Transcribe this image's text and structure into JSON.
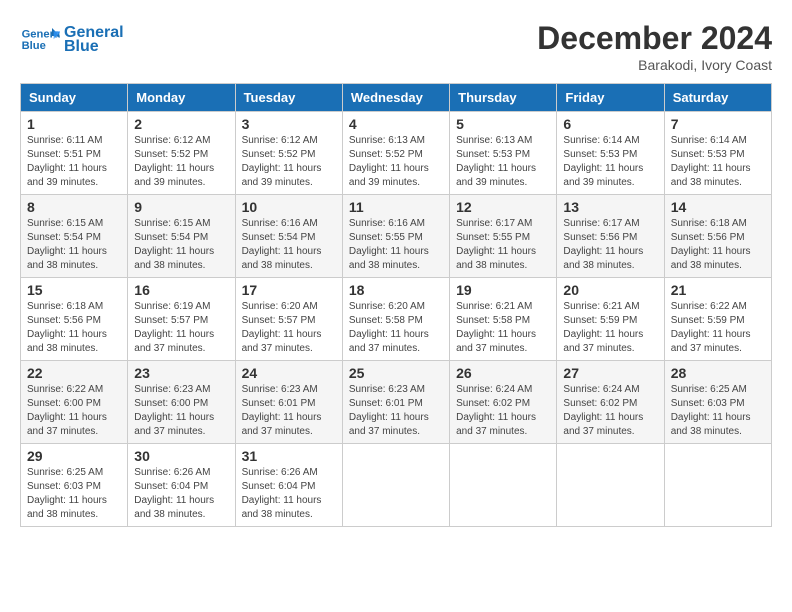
{
  "header": {
    "logo_line1": "General",
    "logo_line2": "Blue",
    "month_title": "December 2024",
    "location": "Barakodi, Ivory Coast"
  },
  "weekdays": [
    "Sunday",
    "Monday",
    "Tuesday",
    "Wednesday",
    "Thursday",
    "Friday",
    "Saturday"
  ],
  "weeks": [
    [
      {
        "day": "1",
        "sunrise": "6:11 AM",
        "sunset": "5:51 PM",
        "daylight": "11 hours and 39 minutes."
      },
      {
        "day": "2",
        "sunrise": "6:12 AM",
        "sunset": "5:52 PM",
        "daylight": "11 hours and 39 minutes."
      },
      {
        "day": "3",
        "sunrise": "6:12 AM",
        "sunset": "5:52 PM",
        "daylight": "11 hours and 39 minutes."
      },
      {
        "day": "4",
        "sunrise": "6:13 AM",
        "sunset": "5:52 PM",
        "daylight": "11 hours and 39 minutes."
      },
      {
        "day": "5",
        "sunrise": "6:13 AM",
        "sunset": "5:53 PM",
        "daylight": "11 hours and 39 minutes."
      },
      {
        "day": "6",
        "sunrise": "6:14 AM",
        "sunset": "5:53 PM",
        "daylight": "11 hours and 39 minutes."
      },
      {
        "day": "7",
        "sunrise": "6:14 AM",
        "sunset": "5:53 PM",
        "daylight": "11 hours and 38 minutes."
      }
    ],
    [
      {
        "day": "8",
        "sunrise": "6:15 AM",
        "sunset": "5:54 PM",
        "daylight": "11 hours and 38 minutes."
      },
      {
        "day": "9",
        "sunrise": "6:15 AM",
        "sunset": "5:54 PM",
        "daylight": "11 hours and 38 minutes."
      },
      {
        "day": "10",
        "sunrise": "6:16 AM",
        "sunset": "5:54 PM",
        "daylight": "11 hours and 38 minutes."
      },
      {
        "day": "11",
        "sunrise": "6:16 AM",
        "sunset": "5:55 PM",
        "daylight": "11 hours and 38 minutes."
      },
      {
        "day": "12",
        "sunrise": "6:17 AM",
        "sunset": "5:55 PM",
        "daylight": "11 hours and 38 minutes."
      },
      {
        "day": "13",
        "sunrise": "6:17 AM",
        "sunset": "5:56 PM",
        "daylight": "11 hours and 38 minutes."
      },
      {
        "day": "14",
        "sunrise": "6:18 AM",
        "sunset": "5:56 PM",
        "daylight": "11 hours and 38 minutes."
      }
    ],
    [
      {
        "day": "15",
        "sunrise": "6:18 AM",
        "sunset": "5:56 PM",
        "daylight": "11 hours and 38 minutes."
      },
      {
        "day": "16",
        "sunrise": "6:19 AM",
        "sunset": "5:57 PM",
        "daylight": "11 hours and 37 minutes."
      },
      {
        "day": "17",
        "sunrise": "6:20 AM",
        "sunset": "5:57 PM",
        "daylight": "11 hours and 37 minutes."
      },
      {
        "day": "18",
        "sunrise": "6:20 AM",
        "sunset": "5:58 PM",
        "daylight": "11 hours and 37 minutes."
      },
      {
        "day": "19",
        "sunrise": "6:21 AM",
        "sunset": "5:58 PM",
        "daylight": "11 hours and 37 minutes."
      },
      {
        "day": "20",
        "sunrise": "6:21 AM",
        "sunset": "5:59 PM",
        "daylight": "11 hours and 37 minutes."
      },
      {
        "day": "21",
        "sunrise": "6:22 AM",
        "sunset": "5:59 PM",
        "daylight": "11 hours and 37 minutes."
      }
    ],
    [
      {
        "day": "22",
        "sunrise": "6:22 AM",
        "sunset": "6:00 PM",
        "daylight": "11 hours and 37 minutes."
      },
      {
        "day": "23",
        "sunrise": "6:23 AM",
        "sunset": "6:00 PM",
        "daylight": "11 hours and 37 minutes."
      },
      {
        "day": "24",
        "sunrise": "6:23 AM",
        "sunset": "6:01 PM",
        "daylight": "11 hours and 37 minutes."
      },
      {
        "day": "25",
        "sunrise": "6:23 AM",
        "sunset": "6:01 PM",
        "daylight": "11 hours and 37 minutes."
      },
      {
        "day": "26",
        "sunrise": "6:24 AM",
        "sunset": "6:02 PM",
        "daylight": "11 hours and 37 minutes."
      },
      {
        "day": "27",
        "sunrise": "6:24 AM",
        "sunset": "6:02 PM",
        "daylight": "11 hours and 37 minutes."
      },
      {
        "day": "28",
        "sunrise": "6:25 AM",
        "sunset": "6:03 PM",
        "daylight": "11 hours and 38 minutes."
      }
    ],
    [
      {
        "day": "29",
        "sunrise": "6:25 AM",
        "sunset": "6:03 PM",
        "daylight": "11 hours and 38 minutes."
      },
      {
        "day": "30",
        "sunrise": "6:26 AM",
        "sunset": "6:04 PM",
        "daylight": "11 hours and 38 minutes."
      },
      {
        "day": "31",
        "sunrise": "6:26 AM",
        "sunset": "6:04 PM",
        "daylight": "11 hours and 38 minutes."
      },
      null,
      null,
      null,
      null
    ]
  ],
  "labels": {
    "sunrise": "Sunrise:",
    "sunset": "Sunset:",
    "daylight": "Daylight:"
  }
}
